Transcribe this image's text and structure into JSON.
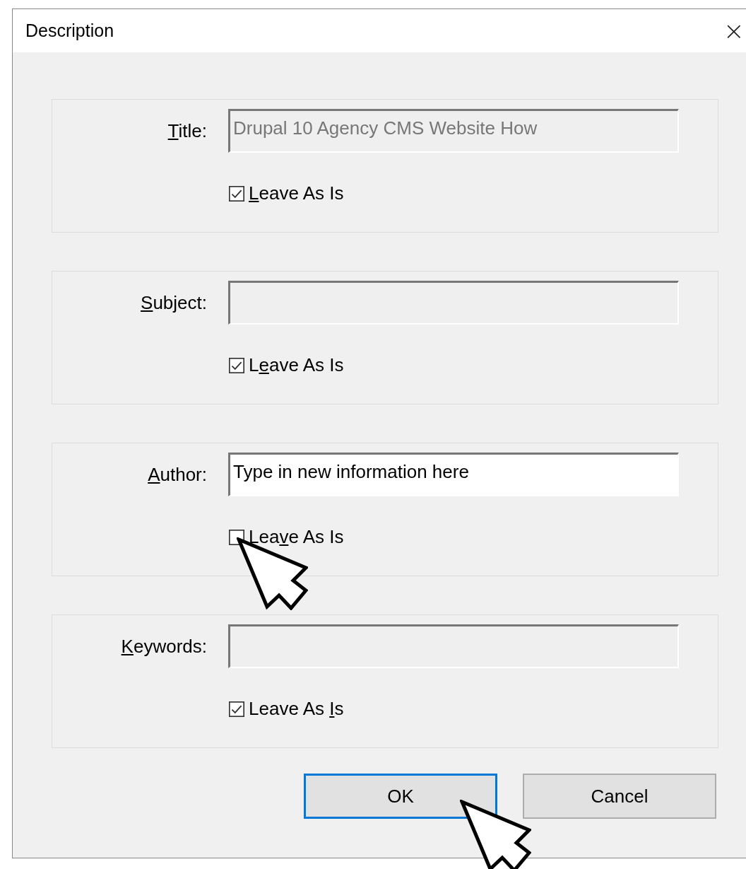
{
  "window": {
    "title": "Description",
    "close": "×"
  },
  "groups": [
    {
      "label": {
        "key": "T",
        "post": "itle:"
      },
      "value": "Drupal 10 Agency CMS Website How",
      "disabled": true,
      "leave": {
        "key": "L",
        "post": "eave As Is"
      },
      "checked": true
    },
    {
      "label": {
        "key": "S",
        "post": "ubject:"
      },
      "disabled": true,
      "leave": {
        "pre": "L",
        "key": "e",
        "post": "ave As Is"
      },
      "checked": true
    },
    {
      "label": {
        "key": "A",
        "post": "uthor:"
      },
      "value": "Type in new information here",
      "disabled": false,
      "leave": {
        "pre": "Lea",
        "key": "v",
        "post": "e As Is"
      },
      "checked": false
    },
    {
      "label": {
        "key": "K",
        "post": "eywords:"
      },
      "disabled": true,
      "leave": {
        "pre": "Leave As ",
        "key": "I",
        "post": "s"
      },
      "checked": true
    }
  ],
  "buttons": [
    {
      "label": "OK",
      "focused": true
    },
    {
      "label": "Cancel",
      "focused": false
    }
  ]
}
